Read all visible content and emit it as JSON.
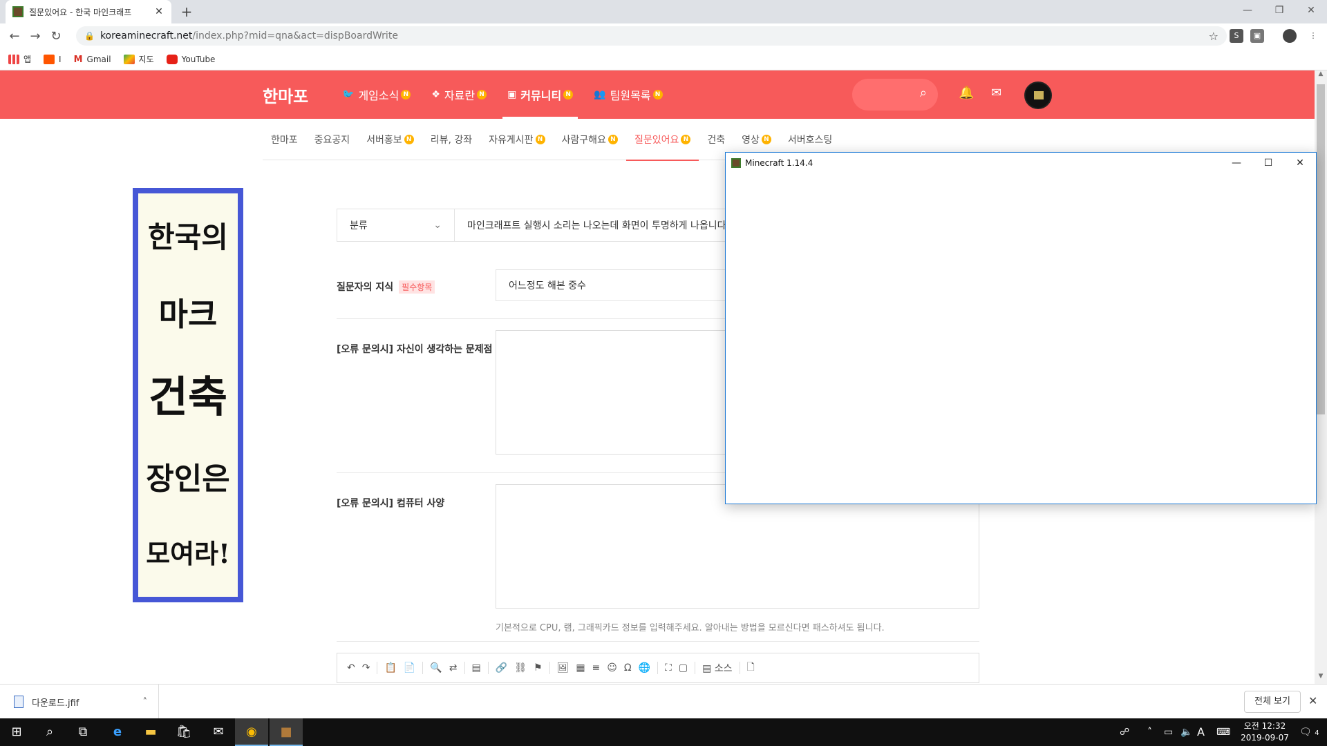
{
  "browser": {
    "tab_title": "질문있어요 - 한국 마인크래프",
    "url_host": "koreaminecraft.net",
    "url_path": "/index.php?mid=qna&act=dispBoardWrite",
    "bookmarks": [
      "앱",
      "I",
      "Gmail",
      "지도",
      "YouTube"
    ]
  },
  "site": {
    "logo": "한마포",
    "main_nav": [
      {
        "label": "게임소식",
        "badge": "N"
      },
      {
        "label": "자료란",
        "badge": "N"
      },
      {
        "label": "커뮤니티",
        "badge": "N"
      },
      {
        "label": "팀원목록",
        "badge": "N"
      }
    ],
    "sub_nav": [
      {
        "label": "한마포",
        "badge": ""
      },
      {
        "label": "중요공지",
        "badge": ""
      },
      {
        "label": "서버홍보",
        "badge": "N"
      },
      {
        "label": "리뷰, 강좌",
        "badge": ""
      },
      {
        "label": "자유게시판",
        "badge": "N"
      },
      {
        "label": "사람구해요",
        "badge": "N"
      },
      {
        "label": "질문있어요",
        "badge": "N"
      },
      {
        "label": "건축",
        "badge": ""
      },
      {
        "label": "영상",
        "badge": "N"
      },
      {
        "label": "서버호스팅",
        "badge": ""
      }
    ]
  },
  "banner": {
    "lines": [
      "한국의",
      "마크",
      "건축",
      "장인은",
      "모여라!"
    ]
  },
  "form": {
    "category_label": "분류",
    "title_value": "마인크래프트 실행시 소리는 나오는데 화면이 투명하게 나옵니다.",
    "knowledge_label": "질문자의 지식",
    "required_badge": "필수항목",
    "knowledge_value": "어느정도 해본 중수",
    "problem_label": "[오류 문의시] 자신이 생각하는 문제점",
    "spec_label": "[오류 문의시] 컴퓨터 사양",
    "spec_hint": "기본적으로 CPU, 램, 그래픽카드 정보를 입력해주세요. 알아내는 방법을 모르신다면 패스하셔도 됩니다.",
    "editor_source_label": "소스"
  },
  "minecraft_window": {
    "title": "Minecraft 1.14.4"
  },
  "downloads": {
    "file_name": "다운로드.jfif",
    "show_all": "전체 보기"
  },
  "taskbar": {
    "ime": "A",
    "time": "오전 12:32",
    "date": "2019-09-07",
    "notifications": "4"
  }
}
